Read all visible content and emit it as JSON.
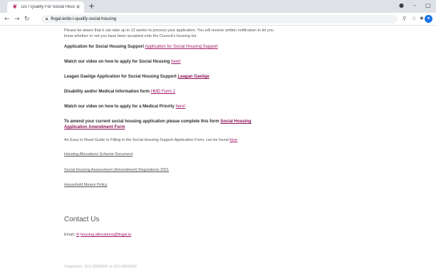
{
  "browser": {
    "tab_title": "Do I Qualify For Social Housing?",
    "new_tab_label": "+",
    "url": "fingal.ie/do-i-qualify-social-housing",
    "icons": {
      "favicon": "fingal-favicon",
      "close": "close-icon",
      "back": "back-arrow-icon",
      "forward": "forward-arrow-icon",
      "reload": "reload-icon",
      "lock": "lock-icon",
      "zoom": "search-icon",
      "star": "star-icon",
      "extensions": "puzzle-icon",
      "profile": "profile-icon"
    },
    "window_controls": [
      "●",
      "–",
      "▢"
    ]
  },
  "content": {
    "intro": "Please be aware that it can take up to 12 weeks to process your application. You will receive written notification to let you know whether or not you have been accepted onto the Council's housing list.",
    "items": [
      {
        "label": "Application for Social Housing Support",
        "link": "Application for Social Housing Support"
      },
      {
        "label": "Watch our video on how to apply for Social Housing",
        "link": "here!"
      },
      {
        "label": "Leagan Gaeilge Application for Social Housing Support",
        "link": "Leagan Gaeilge"
      },
      {
        "label": "Disability and/or Medical Information form",
        "link": "HMD Form 1"
      },
      {
        "label": "Watch our video on how to apply for a Medical Priority",
        "link": "here!"
      }
    ],
    "amend_label": "To amend your current social housing application please complete this form",
    "amend_link_1": "Social Housing",
    "amend_link_2": "Application Amendment Form",
    "guide_text": "An Easy to Read Guide to Filling in the Social Housing Support Application Form, can be found",
    "guide_link": "here",
    "links": [
      "Housing Allocations Scheme Document",
      "Social Housing Assessment (Amendment) Regulations 2021",
      "Household Means Policy"
    ],
    "contact_heading": "Contact Us",
    "email_label": "Email:",
    "email_value": "housing.allocations@fingal.ie",
    "faded_line": "Telephone: (01) 8905000 or (01) 8905000"
  }
}
